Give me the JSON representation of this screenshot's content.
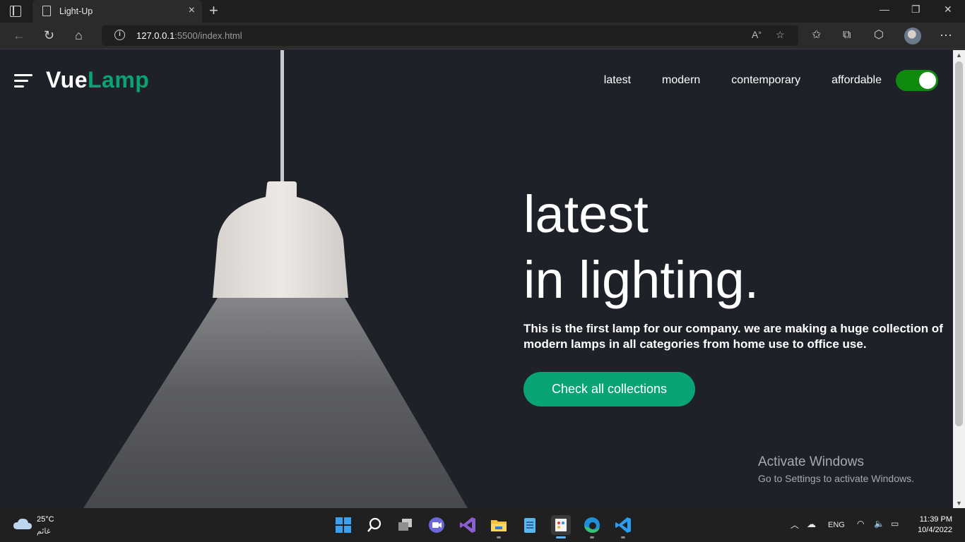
{
  "browser": {
    "tab_title": "Light-Up",
    "url_host": "127.0.0.1",
    "url_path": ":5500/index.html",
    "new_tab": "+",
    "close_tab": "×"
  },
  "site": {
    "logo_part1": "Vue",
    "logo_part2": "Lamp",
    "nav": [
      "latest",
      "modern",
      "contemporary",
      "affordable"
    ],
    "toggle_on": true,
    "headline_line1": "latest",
    "headline_line2": "in lighting.",
    "description": "This is the first lamp for our company. we are making a huge collection of modern lamps in all categories from home use to office use.",
    "cta_label": "Check all collections",
    "colors": {
      "accent": "#0aa374",
      "background": "#1f2128",
      "toggle": "#0f8a0f"
    }
  },
  "watermark": {
    "title": "Activate Windows",
    "subtitle": "Go to Settings to activate Windows."
  },
  "taskbar": {
    "temperature": "25°C",
    "condition": "غائم",
    "language": "ENG",
    "time": "11:39 PM",
    "date": "10/4/2022",
    "apps": [
      "windows-start-icon",
      "search-icon",
      "task-view-icon",
      "teams-chat-icon",
      "visual-studio-icon",
      "file-explorer-icon",
      "notepad-icon",
      "paint-icon",
      "edge-icon",
      "vscode-icon"
    ]
  }
}
